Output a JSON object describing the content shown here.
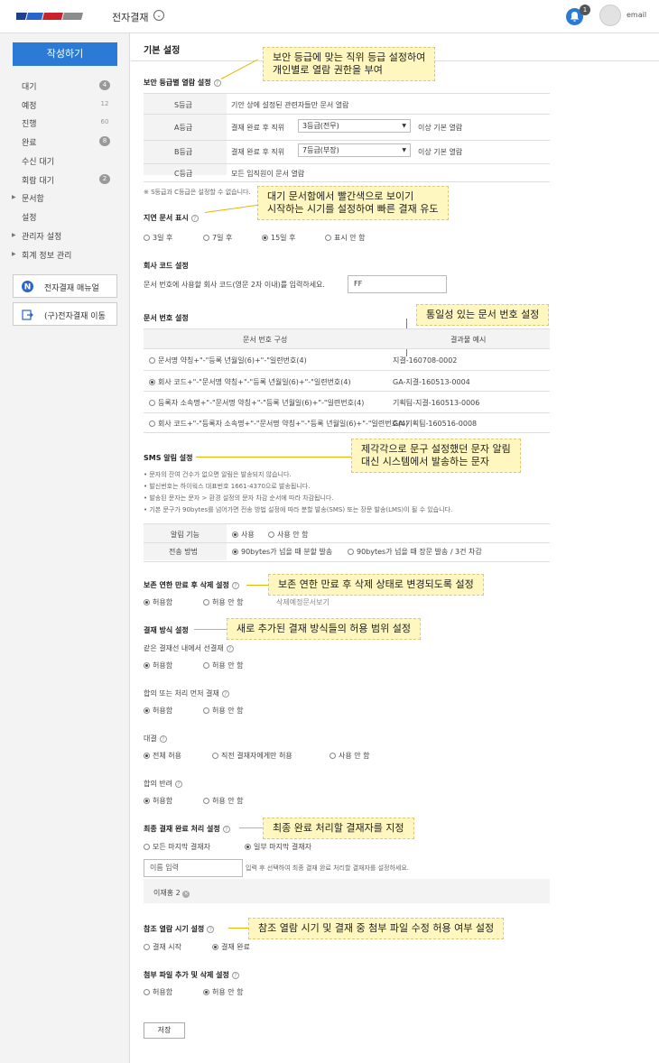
{
  "header": {
    "app_title": "전자결재",
    "notif_count": "1",
    "user": "email"
  },
  "sidebar": {
    "write_button": "작성하기",
    "items": [
      {
        "label": "대기",
        "count": "4"
      },
      {
        "label": "예정",
        "count": "12"
      },
      {
        "label": "진행",
        "count": "60"
      },
      {
        "label": "완료",
        "count": "8"
      },
      {
        "label": "수신 대기",
        "count": ""
      },
      {
        "label": "회람 대기",
        "count": "2"
      },
      {
        "label": "문서함",
        "count": ""
      },
      {
        "label": "설정",
        "count": ""
      },
      {
        "label": "관리자 설정",
        "count": ""
      },
      {
        "label": "회계 정보 관리",
        "count": ""
      }
    ],
    "manual_button": "전자결재 매뉴얼",
    "legacy_button": "(구)전자결재 이동"
  },
  "page_title": "기본 설정",
  "security": {
    "title": "보안 등급별 열람 설정",
    "rows": [
      {
        "grade": "S등급",
        "desc": "기안 상에 설정된 관련자들만 문서 열람"
      },
      {
        "grade": "A등급",
        "desc": "결재 완료 후 직위",
        "select": "3등급(전무)",
        "suffix": "이상 기본 열람"
      },
      {
        "grade": "B등급",
        "desc": "결재 완료 후 직위",
        "select": "7등급(부장)",
        "suffix": "이상 기본 열람"
      },
      {
        "grade": "C등급",
        "desc": "모든 임직원이 문서 열람"
      }
    ],
    "note": "※ S등급과 C등급은 설정할 수 없습니다.",
    "callout": [
      "보안 등급에 맞는 직위 등급 설정하여",
      "개인별로 열람 권한을 부여"
    ]
  },
  "delay": {
    "title": "지연 문서 표시",
    "options": [
      "3일 후",
      "7일 후",
      "15일 후",
      "표시 안 함"
    ],
    "selected": 2,
    "callout": [
      "대기 문서함에서 빨간색으로  보이기",
      "시작하는 시기를 설정하여 빠른 결재 유도"
    ]
  },
  "company_code": {
    "title": "회사 코드 설정",
    "desc": "문서 번호에 사용할 회사 코드(영문 2자 이내)를 입력하세요.",
    "value": "FF"
  },
  "doc_number": {
    "title": "문서 번호 설정",
    "header_left": "문서 번호 구성",
    "header_right": "결과물 예시",
    "rows": [
      {
        "format": "문서명 약칭+\"-\"등록 년월일(6)+\"-\"일련번호(4)",
        "example": "지결-160708-0002"
      },
      {
        "format": "회사 코드+\"-\"문서명 약칭+\"-\"등록 년월일(6)+\"-\"일련번호(4)",
        "example": "GA-지결-160513-0004"
      },
      {
        "format": "등록자 소속명+\"-\"문서명 약칭+\"-\"등록 년월일(6)+\"-\"일련번호(4)",
        "example": "기획팀-지결-160513-0006"
      },
      {
        "format": "회사 코드+\"-\"등록자 소속명+\"-\"문서명 약칭+\"-\"등록 년월일(6)+\"-\"일련번호(4)",
        "example": "GA-기획팀-160516-0008"
      }
    ],
    "selected": 1,
    "callout": "통일성 있는 문서 번호 설정"
  },
  "sms": {
    "title": "SMS 알림 설정",
    "notes": [
      "• 문자의 잔여 건수가 없으면 알림은 발송되지 않습니다.",
      "• 발신번호는 하이웍스 대표번호 1661-4370으로 발송됩니다.",
      "• 발송된 문자는 문자 > 환경 설정의 문자 차감 순서에 따라 차감됩니다.",
      "• 기본 문구가 90bytes를 넘어가면 전송 방법 설정에 따라 분할 발송(SMS) 또는 장문 발송(LMS)이 될 수 있습니다."
    ],
    "alarm_label": "알림 기능",
    "alarm_options": [
      "사용",
      "사용 안 함"
    ],
    "send_label": "전송 방법",
    "send_options": [
      "90bytes가 넘을 때 분할 발송",
      "90bytes가 넘을 때 장문 발송 / 3건 차감"
    ],
    "callout": [
      "제각각으로 문구 설정했던 문자 알림",
      "대신 시스템에서 발송하는 문자"
    ]
  },
  "retention": {
    "title": "보존 연한 만료 후 삭제 설정",
    "options": [
      "허용함",
      "허용 안 함"
    ],
    "link": "삭제예정문서보기",
    "callout": "보존 연한 만료 후 삭제 상태로 변경되도록 설정"
  },
  "method": {
    "title": "결재 방식 설정",
    "callout": "새로 추가된 결재 방식들의 허용 범위 설정",
    "groups": [
      {
        "title": "같은 결재선 내에서 선결재",
        "options": [
          "허용함",
          "허용 안 함"
        ]
      },
      {
        "title": "합의 또는 처리 먼저 결재",
        "options": [
          "허용함",
          "허용 안 함"
        ]
      },
      {
        "title": "대결",
        "options": [
          "전체 허용",
          "직전 결재자에게만 허용",
          "사용 안 함"
        ]
      },
      {
        "title": "합의 반려",
        "options": [
          "허용함",
          "허용 안 함"
        ]
      }
    ]
  },
  "final": {
    "title": "최종 결재 완료 처리 설정",
    "options": [
      "모든 마지막 결재자",
      "일부 마지막 결재자"
    ],
    "input_placeholder": "이름 입력",
    "hint": "입력 후 선택하여 최종 결재 완료 처리할 결재자를 설정하세요.",
    "tag": "이재홍 2",
    "callout": "최종 완료 처리할 결재자를 지정"
  },
  "reference": {
    "title": "참조 열람 시기 설정",
    "options": [
      "결재 시작",
      "결재 완료"
    ],
    "callout": "참조 열람 시기 및 결재 중 첨부 파일 수정 허용 여부 설정"
  },
  "attachment": {
    "title": "첨부 파일 추가 및 삭제 설정",
    "options": [
      "허용함",
      "허용 안 함"
    ]
  },
  "save": "저장"
}
